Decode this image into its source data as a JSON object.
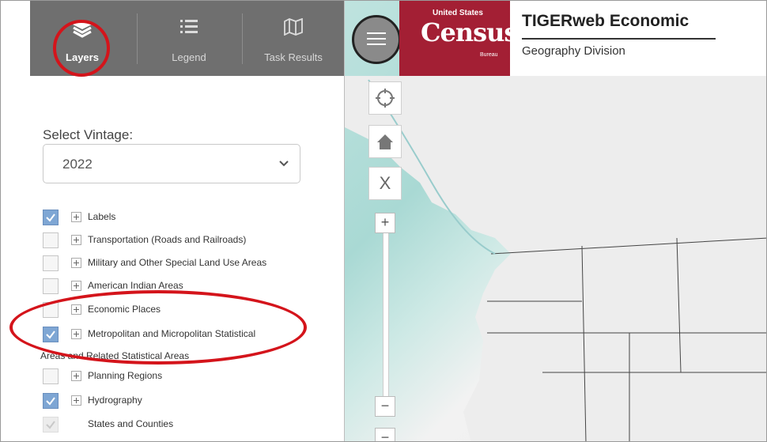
{
  "tabs": [
    {
      "label": "Layers",
      "icon": "layers-icon",
      "active": true
    },
    {
      "label": "Legend",
      "icon": "legend-list-icon",
      "active": false
    },
    {
      "label": "Task Results",
      "icon": "map-icon",
      "active": false
    }
  ],
  "vintage": {
    "label": "Select Vintage:",
    "value": "2022"
  },
  "layers": [
    {
      "label": "Labels",
      "checked": true
    },
    {
      "label": "Transportation (Roads and Railroads)",
      "checked": false
    },
    {
      "label": "Military and Other Special Land Use Areas",
      "checked": false
    },
    {
      "label": "American Indian Areas",
      "checked": false
    },
    {
      "label": "Economic Places",
      "checked": false
    },
    {
      "label": "Metropolitan and Micropolitan Statistical",
      "continuation": "Areas and Related Statistical Areas",
      "checked": true
    },
    {
      "label": "Planning Regions",
      "checked": false
    },
    {
      "label": "Hydrography",
      "checked": true
    },
    {
      "label": "States and Counties",
      "checked": true,
      "disabled": true
    }
  ],
  "header": {
    "logo_top": "United States",
    "logo_main": "Census",
    "logo_bottom": "Bureau",
    "title": "TIGERweb Economic",
    "subtitle": "Geography Division"
  },
  "map_controls": {
    "locate_icon": "crosshair-icon",
    "home_icon": "home-icon",
    "clear_label": "X",
    "zoom_in": "+",
    "zoom_out": "−"
  },
  "colors": {
    "census_red": "#a31f34",
    "tab_bar": "#6f6f6f",
    "highlight": "#d4141b",
    "checkbox_checked": "#7ea6d4"
  }
}
